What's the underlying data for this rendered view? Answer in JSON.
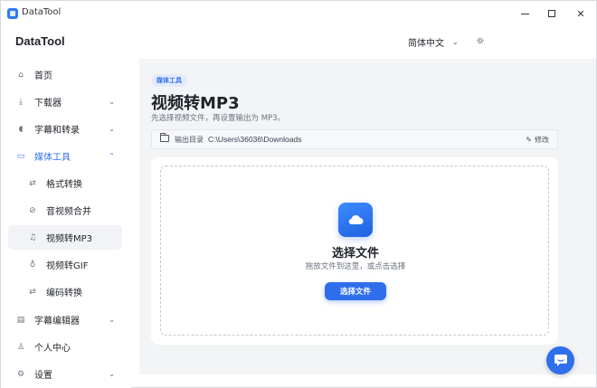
{
  "window": {
    "title": "DataTool"
  },
  "header": {
    "brand": "DataTool",
    "language": "简体中文",
    "language_icon": "chevron-down-icon",
    "theme_icon": "sun-icon"
  },
  "sidebar": {
    "items": [
      {
        "label": "首页",
        "icon": "home-icon",
        "icon_glyph": "⌂"
      },
      {
        "label": "下载器",
        "icon": "download-icon",
        "icon_glyph": "⤓"
      },
      {
        "label": "字幕和转录",
        "icon": "microphone-icon",
        "icon_glyph": "◖"
      },
      {
        "label": "媒体工具",
        "icon": "video-icon",
        "icon_glyph": "▭"
      },
      {
        "label": "格式转换",
        "icon": "swap-icon",
        "icon_glyph": "⇄"
      },
      {
        "label": "音视频合并",
        "icon": "link-icon",
        "icon_glyph": "⊘"
      },
      {
        "label": "视频转MP3",
        "icon": "music-icon",
        "icon_glyph": "♫"
      },
      {
        "label": "视频转GIF",
        "icon": "bulb-icon",
        "icon_glyph": "♁"
      },
      {
        "label": "编码转换",
        "icon": "swap-icon",
        "icon_glyph": "⇄"
      },
      {
        "label": "字幕编辑器",
        "icon": "subtitle-icon",
        "icon_glyph": "▤"
      },
      {
        "label": "个人中心",
        "icon": "user-icon",
        "icon_glyph": "♙"
      },
      {
        "label": "设置",
        "icon": "gear-icon",
        "icon_glyph": "⚙"
      }
    ]
  },
  "main": {
    "tag": "媒体工具",
    "title": "视频转MP3",
    "description": "先选择视频文件，再设置输出为 MP3。",
    "output_dir": {
      "label": "输出目录",
      "path": "C:\\Users\\36036\\Downloads",
      "edit_label": "修改"
    },
    "drop": {
      "title": "选择文件",
      "subtitle": "拖放文件到这里，或点击选择",
      "button": "选择文件"
    }
  },
  "colors": {
    "accent": "#2f6fec",
    "main_bg": "#f3f4f6",
    "active_nav_bg": "#f1f3f6"
  }
}
